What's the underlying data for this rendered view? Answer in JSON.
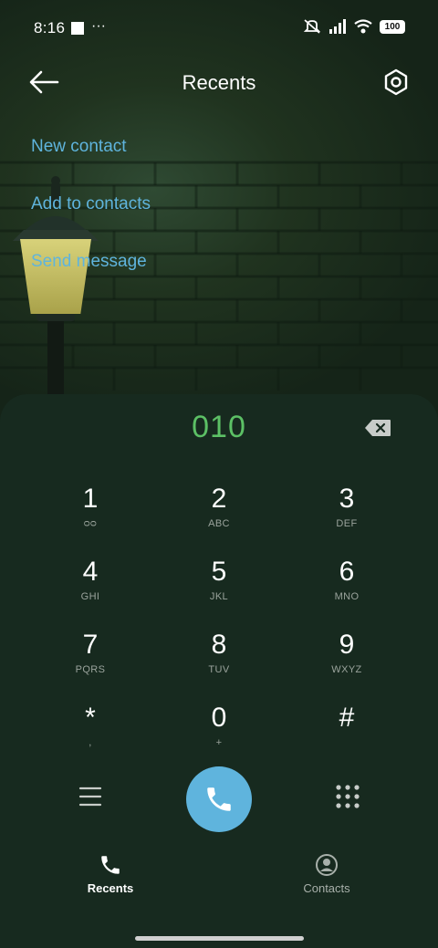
{
  "status_bar": {
    "time": "8:16",
    "more": "···",
    "battery": "100"
  },
  "header": {
    "title": "Recents"
  },
  "options": [
    "New contact",
    "Add to contacts",
    "Send message"
  ],
  "dialer": {
    "number": "010",
    "keys": [
      {
        "digit": "1",
        "letters": "ᴑᴑ"
      },
      {
        "digit": "2",
        "letters": "ABC"
      },
      {
        "digit": "3",
        "letters": "DEF"
      },
      {
        "digit": "4",
        "letters": "GHI"
      },
      {
        "digit": "5",
        "letters": "JKL"
      },
      {
        "digit": "6",
        "letters": "MNO"
      },
      {
        "digit": "7",
        "letters": "PQRS"
      },
      {
        "digit": "8",
        "letters": "TUV"
      },
      {
        "digit": "9",
        "letters": "WXYZ"
      },
      {
        "digit": "*",
        "letters": ","
      },
      {
        "digit": "0",
        "letters": "+"
      },
      {
        "digit": "#",
        "letters": ""
      }
    ]
  },
  "tabs": {
    "recents": "Recents",
    "contacts": "Contacts"
  },
  "colors": {
    "accent": "#5fb4dd",
    "number": "#5cc065",
    "panel": "#172a1f"
  }
}
